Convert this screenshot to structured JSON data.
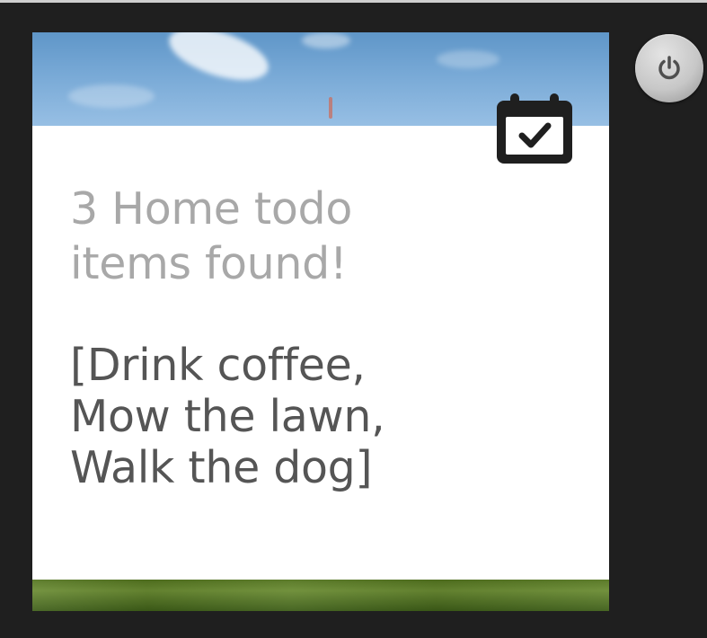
{
  "colors": {
    "background": "#1f1f1f",
    "card": "#ffffff",
    "title_text": "#a8a8a8",
    "body_text": "#555555",
    "sky": "#78a9d6",
    "grass": "#5f8328",
    "power_button": "#c7c7c7"
  },
  "icons": {
    "calendar": "calendar-check-icon",
    "power": "power-icon"
  },
  "card": {
    "title": "3 Home todo\nitems found!",
    "body": "[Drink coffee,\nMow the lawn,\nWalk the dog]"
  }
}
